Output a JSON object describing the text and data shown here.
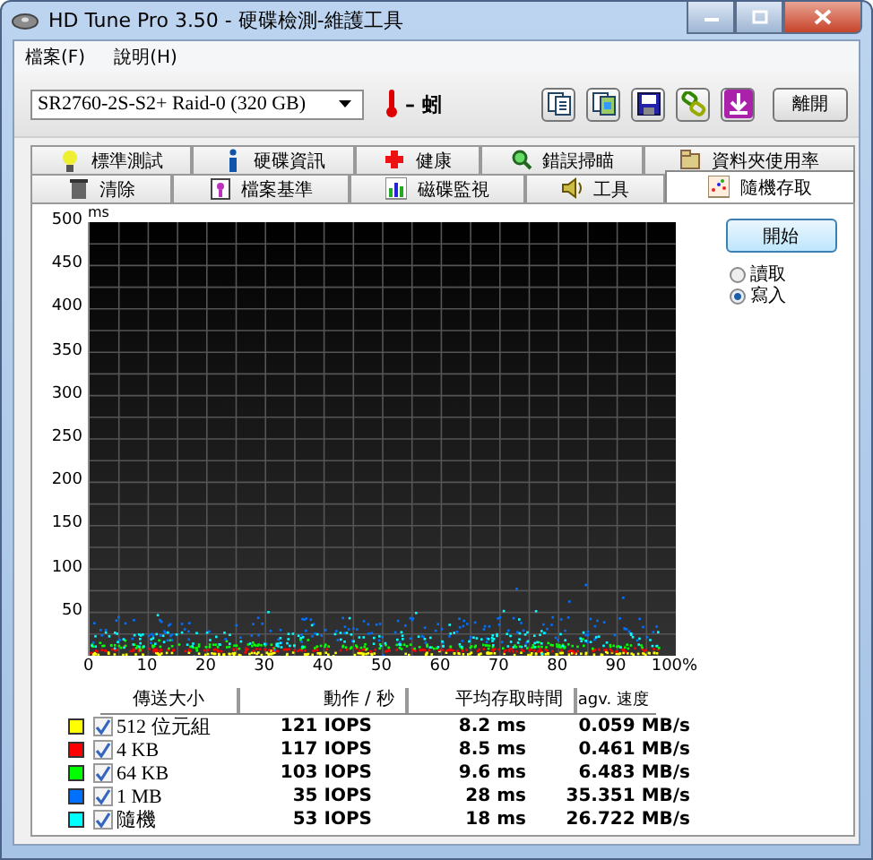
{
  "window": {
    "title": "HD Tune Pro 3.50 - 硬碟檢測-維護工具"
  },
  "menu": [
    "檔案(F)",
    "說明(H)"
  ],
  "toolbar": {
    "drive": "SR2760-2S-S2+ Raid-0 (320 GB)",
    "temperature": "– 蚓",
    "exit_button": "離開"
  },
  "tabs": [
    [
      {
        "label": "標準測試",
        "selected": false
      },
      {
        "label": "硬碟資訊",
        "selected": false
      },
      {
        "label": "健康",
        "selected": false
      },
      {
        "label": "錯誤掃瞄",
        "selected": false
      },
      {
        "label": "資料夾使用率",
        "selected": false
      }
    ],
    [
      {
        "label": "清除",
        "selected": false
      },
      {
        "label": "檔案基準",
        "selected": false
      },
      {
        "label": "磁碟監視",
        "selected": false
      },
      {
        "label": "工具",
        "selected": false
      },
      {
        "label": "隨機存取",
        "selected": true
      }
    ]
  ],
  "chart": {
    "unit": "ms",
    "y_labels": [
      "500",
      "450",
      "400",
      "350",
      "300",
      "250",
      "200",
      "150",
      "100",
      "50"
    ],
    "x_labels": [
      "0",
      "10",
      "20",
      "30",
      "40",
      "50",
      "60",
      "70",
      "80",
      "90",
      "100%"
    ]
  },
  "controls": {
    "start_button": "開始",
    "modes": [
      {
        "label": "讀取",
        "selected": false
      },
      {
        "label": "寫入",
        "selected": true
      }
    ]
  },
  "results": {
    "columns": [
      "傳送大小",
      "動作 / 秒",
      "平均存取時間",
      "agv. 速度"
    ],
    "rows": [
      {
        "color": "#ffff00",
        "checked": true,
        "size": "512 位元組",
        "iops": "121 IOPS",
        "access": "8.2 ms",
        "speed": "0.059 MB/s"
      },
      {
        "color": "#ff0000",
        "checked": true,
        "size": "4 KB",
        "iops": "117 IOPS",
        "access": "8.5 ms",
        "speed": "0.461 MB/s"
      },
      {
        "color": "#00ff00",
        "checked": true,
        "size": "64 KB",
        "iops": "103 IOPS",
        "access": "9.6 ms",
        "speed": "6.483 MB/s"
      },
      {
        "color": "#0070ff",
        "checked": true,
        "size": "1 MB",
        "iops": "35 IOPS",
        "access": "28 ms",
        "speed": "35.351 MB/s"
      },
      {
        "color": "#00ffff",
        "checked": true,
        "size": "隨機",
        "iops": "53 IOPS",
        "access": "18 ms",
        "speed": "26.722 MB/s"
      }
    ]
  }
}
